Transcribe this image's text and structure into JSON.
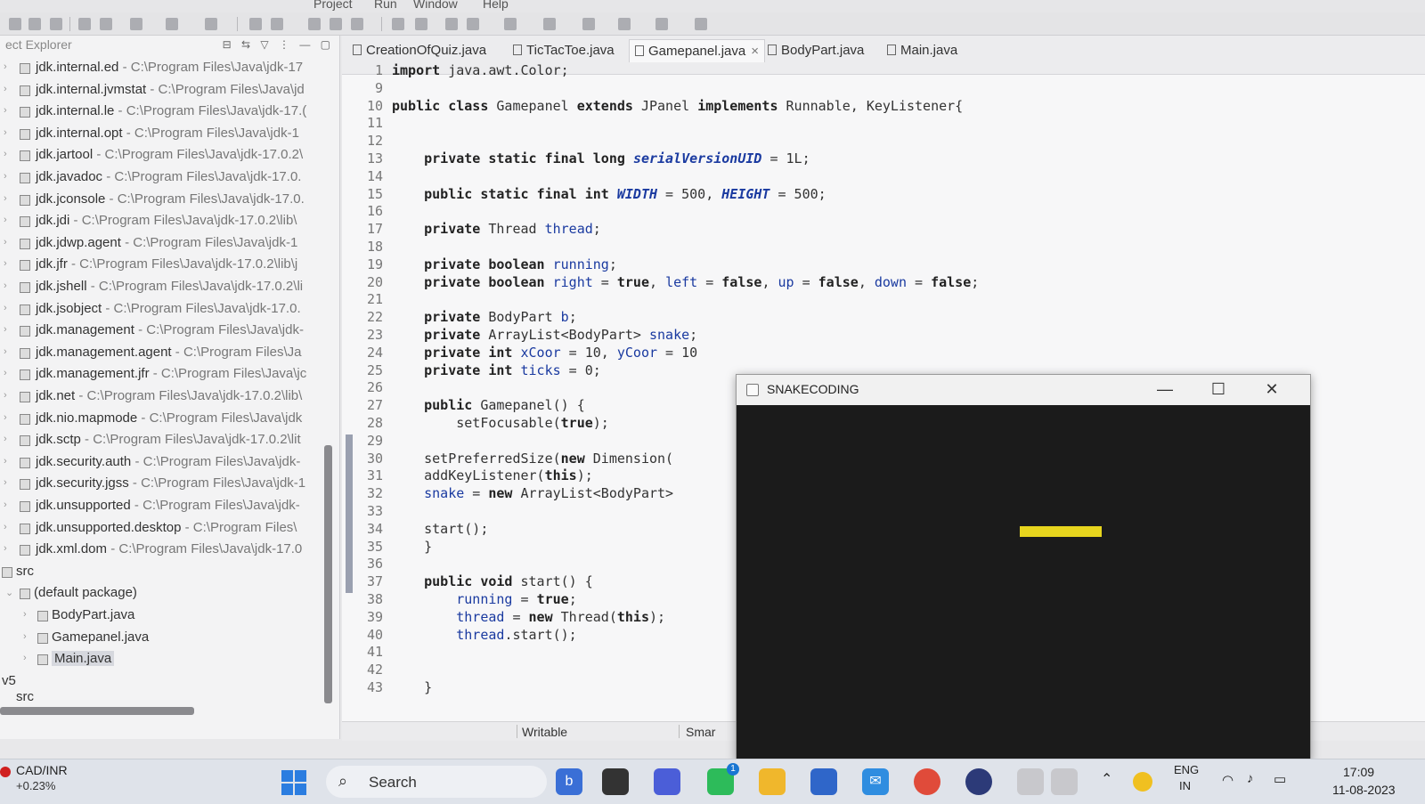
{
  "menubar": {
    "items": [
      "Project",
      "Run",
      "Window",
      "Help"
    ]
  },
  "explorer": {
    "title": "ect Explorer",
    "libraries": [
      {
        "name": "jdk.internal.ed",
        "path": " - C:\\Program Files\\Java\\jdk-17"
      },
      {
        "name": "jdk.internal.jvmstat",
        "path": " - C:\\Program Files\\Java\\jd"
      },
      {
        "name": "jdk.internal.le",
        "path": " - C:\\Program Files\\Java\\jdk-17.("
      },
      {
        "name": "jdk.internal.opt",
        "path": " - C:\\Program Files\\Java\\jdk-1"
      },
      {
        "name": "jdk.jartool",
        "path": " - C:\\Program Files\\Java\\jdk-17.0.2\\"
      },
      {
        "name": "jdk.javadoc",
        "path": " - C:\\Program Files\\Java\\jdk-17.0."
      },
      {
        "name": "jdk.jconsole",
        "path": " - C:\\Program Files\\Java\\jdk-17.0."
      },
      {
        "name": "jdk.jdi",
        "path": " - C:\\Program Files\\Java\\jdk-17.0.2\\lib\\"
      },
      {
        "name": "jdk.jdwp.agent",
        "path": " - C:\\Program Files\\Java\\jdk-1"
      },
      {
        "name": "jdk.jfr",
        "path": " - C:\\Program Files\\Java\\jdk-17.0.2\\lib\\j"
      },
      {
        "name": "jdk.jshell",
        "path": " - C:\\Program Files\\Java\\jdk-17.0.2\\li"
      },
      {
        "name": "jdk.jsobject",
        "path": " - C:\\Program Files\\Java\\jdk-17.0."
      },
      {
        "name": "jdk.management",
        "path": " - C:\\Program Files\\Java\\jdk-"
      },
      {
        "name": "jdk.management.agent",
        "path": " - C:\\Program Files\\Ja"
      },
      {
        "name": "jdk.management.jfr",
        "path": " - C:\\Program Files\\Java\\jc"
      },
      {
        "name": "jdk.net",
        "path": " - C:\\Program Files\\Java\\jdk-17.0.2\\lib\\"
      },
      {
        "name": "jdk.nio.mapmode",
        "path": " - C:\\Program Files\\Java\\jdk"
      },
      {
        "name": "jdk.sctp",
        "path": " - C:\\Program Files\\Java\\jdk-17.0.2\\lit"
      },
      {
        "name": "jdk.security.auth",
        "path": " - C:\\Program Files\\Java\\jdk-"
      },
      {
        "name": "jdk.security.jgss",
        "path": " - C:\\Program Files\\Java\\jdk-1"
      },
      {
        "name": "jdk.unsupported",
        "path": " - C:\\Program Files\\Java\\jdk-"
      },
      {
        "name": "jdk.unsupported.desktop",
        "path": " - C:\\Program Files\\"
      },
      {
        "name": "jdk.xml.dom",
        "path": " - C:\\Program Files\\Java\\jdk-17.0"
      }
    ],
    "src_label": "src",
    "package_label": "(default package)",
    "files": [
      "BodyPart.java",
      "Gamepanel.java",
      "Main.java"
    ],
    "footer_label": "v5",
    "footer_src": "src"
  },
  "editor": {
    "tabs": [
      {
        "label": "CreationOfQuiz.java"
      },
      {
        "label": "TicTacToe.java"
      },
      {
        "label": "Gamepanel.java",
        "close": "×"
      },
      {
        "label": "BodyPart.java"
      },
      {
        "label": "Main.java"
      }
    ],
    "lines": [
      {
        "n": "1",
        "text": "import java.awt.Color;"
      },
      {
        "n": "9",
        "text": ""
      },
      {
        "n": "10",
        "text": "public class Gamepanel extends JPanel implements Runnable, KeyListener{"
      },
      {
        "n": "11",
        "text": ""
      },
      {
        "n": "12",
        "text": ""
      },
      {
        "n": "13",
        "text": "    private static final long serialVersionUID = 1L;"
      },
      {
        "n": "14",
        "text": ""
      },
      {
        "n": "15",
        "text": "    public static final int WIDTH = 500, HEIGHT = 500;"
      },
      {
        "n": "16",
        "text": ""
      },
      {
        "n": "17",
        "text": "    private Thread thread;"
      },
      {
        "n": "18",
        "text": ""
      },
      {
        "n": "19",
        "text": "    private boolean running;"
      },
      {
        "n": "20",
        "text": "    private boolean right = true, left = false, up = false, down = false;"
      },
      {
        "n": "21",
        "text": ""
      },
      {
        "n": "22",
        "text": "    private BodyPart b;"
      },
      {
        "n": "23",
        "text": "    private ArrayList<BodyPart> snake;"
      },
      {
        "n": "24",
        "text": "    private int xCoor = 10, yCoor = 10"
      },
      {
        "n": "25",
        "text": "    private int ticks = 0;"
      },
      {
        "n": "26",
        "text": ""
      },
      {
        "n": "27",
        "text": "    public Gamepanel() {"
      },
      {
        "n": "28",
        "text": "        setFocusable(true);"
      },
      {
        "n": "29",
        "text": ""
      },
      {
        "n": "30",
        "text": "    setPreferredSize(new Dimension("
      },
      {
        "n": "31",
        "text": "    addKeyListener(this);"
      },
      {
        "n": "32",
        "text": "    snake = new ArrayList<BodyPart>"
      },
      {
        "n": "33",
        "text": ""
      },
      {
        "n": "34",
        "text": "    start();"
      },
      {
        "n": "35",
        "text": "    }"
      },
      {
        "n": "36",
        "text": ""
      },
      {
        "n": "37",
        "text": "    public void start() {"
      },
      {
        "n": "38",
        "text": "        running = true;"
      },
      {
        "n": "39",
        "text": "        thread = new Thread(this);"
      },
      {
        "n": "40",
        "text": "        thread.start();"
      },
      {
        "n": "41",
        "text": ""
      },
      {
        "n": "42",
        "text": ""
      },
      {
        "n": "43",
        "text": "    }"
      }
    ],
    "status": {
      "mode": "Writable",
      "insert": "Smar"
    }
  },
  "game_window": {
    "title": "SNAKECODING",
    "snake_color": "#e7d51e",
    "background": "#1b1b1b"
  },
  "taskbar": {
    "stock_name": "CAD/INR",
    "stock_change": "+0.23%",
    "search_label": "Search",
    "lang_top": "ENG",
    "lang_bottom": "IN",
    "time": "17:09",
    "date": "11-08-2023",
    "chat_badge": "1"
  }
}
